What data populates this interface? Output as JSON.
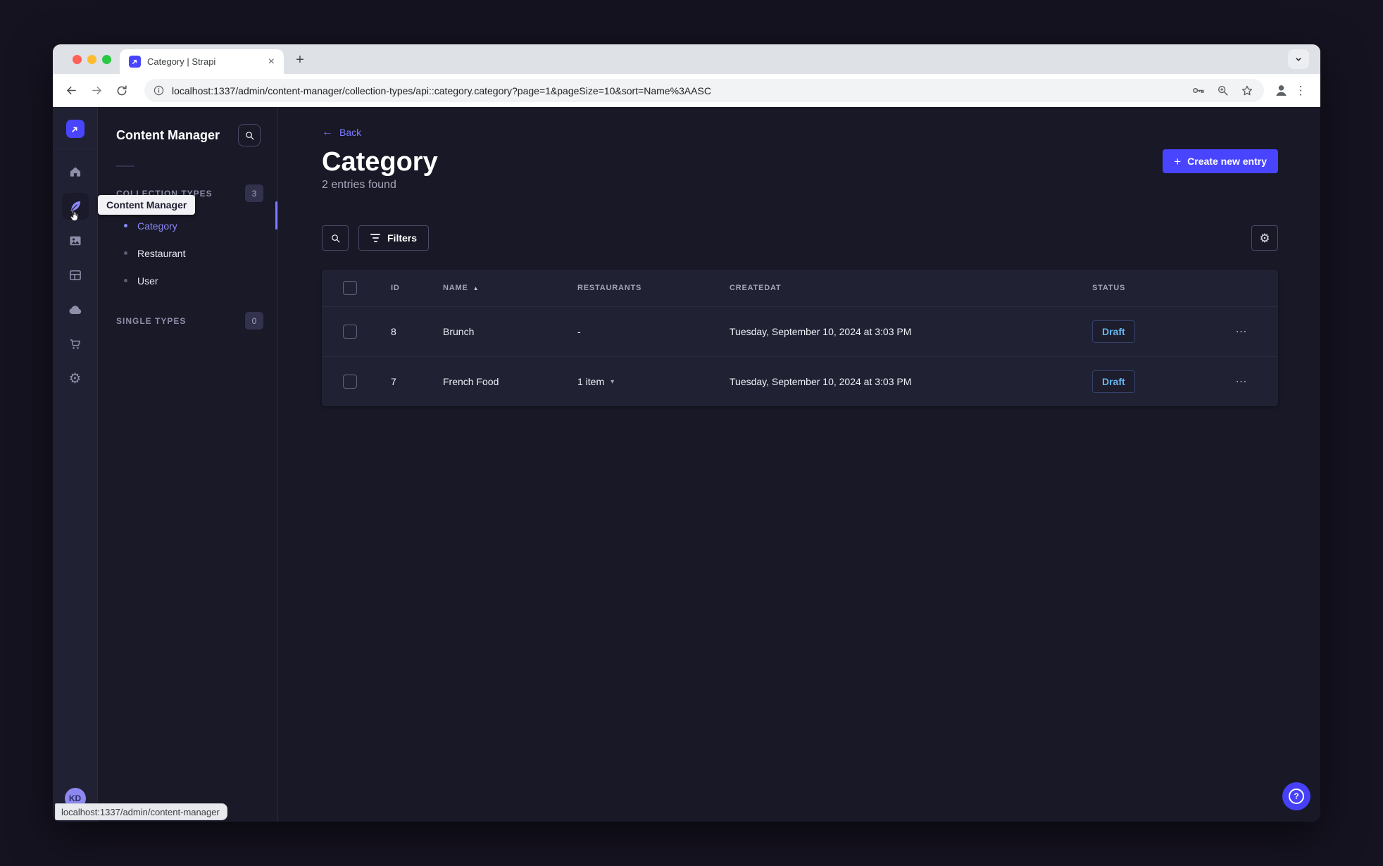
{
  "browser": {
    "tab_title": "Category | Strapi",
    "url": "localhost:1337/admin/content-manager/collection-types/api::category.category?page=1&pageSize=10&sort=Name%3AASC",
    "status_link": "localhost:1337/admin/content-manager"
  },
  "sidebar": {
    "tooltip": "Content Manager",
    "avatar_initials": "KD"
  },
  "subnav": {
    "title": "Content Manager",
    "collection_types": {
      "label": "COLLECTION TYPES",
      "count": "3",
      "items": [
        {
          "label": "Category",
          "active": true
        },
        {
          "label": "Restaurant",
          "active": false
        },
        {
          "label": "User",
          "active": false
        }
      ]
    },
    "single_types": {
      "label": "SINGLE TYPES",
      "count": "0"
    }
  },
  "main": {
    "back_label": "Back",
    "title": "Category",
    "subtitle": "2 entries found",
    "create_button": "Create new entry",
    "filters_button": "Filters",
    "table": {
      "headers": {
        "id": "ID",
        "name": "NAME",
        "restaurants": "RESTAURANTS",
        "createdat": "CREATEDAT",
        "status": "STATUS"
      },
      "rows": [
        {
          "id": "8",
          "name": "Brunch",
          "restaurants": "-",
          "createdat": "Tuesday, September 10, 2024 at 3:03 PM",
          "status": "Draft"
        },
        {
          "id": "7",
          "name": "French Food",
          "restaurants": "1 item",
          "createdat": "Tuesday, September 10, 2024 at 3:03 PM",
          "status": "Draft"
        }
      ]
    }
  },
  "glyphs": {
    "close": "×",
    "plus_tab": "+",
    "plus": "+",
    "back_arrow": "←",
    "kebab_vertical": "⋮",
    "kebab_horizontal": "⋯",
    "sort_asc": "▲",
    "chevron_down_small": "▾",
    "gear": "⚙"
  },
  "colors": {
    "accent": "#4945ff",
    "accent_light": "#7b79ff",
    "draft_text": "#66b7f1",
    "surface": "#212134",
    "background": "#181826"
  }
}
